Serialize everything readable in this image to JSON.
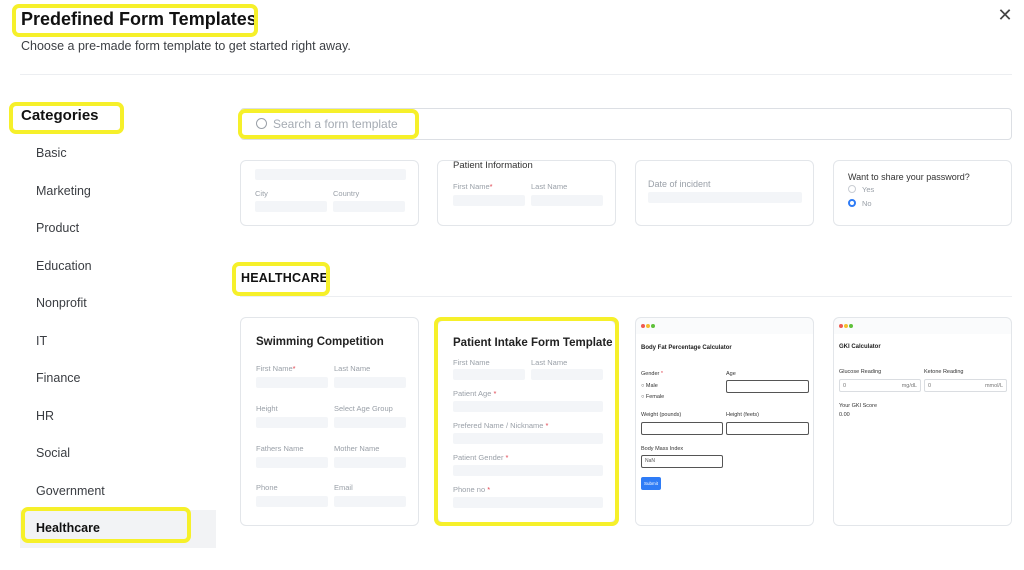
{
  "header": {
    "title": "Predefined Form Templates",
    "subtitle": "Choose a pre-made form template to get started right away.",
    "close_icon": "close-icon"
  },
  "sidebar": {
    "title": "Categories",
    "items": [
      {
        "label": "Basic"
      },
      {
        "label": "Marketing"
      },
      {
        "label": "Product"
      },
      {
        "label": "Education"
      },
      {
        "label": "Nonprofit"
      },
      {
        "label": "IT"
      },
      {
        "label": "Finance"
      },
      {
        "label": "HR"
      },
      {
        "label": "Social"
      },
      {
        "label": "Government"
      },
      {
        "label": "Healthcare",
        "active": true
      }
    ]
  },
  "search": {
    "placeholder": "Search a form template",
    "value": ""
  },
  "top_row": {
    "card1": {
      "fields": [
        "City",
        "Country"
      ]
    },
    "card2": {
      "title": "Patient Information",
      "fields": [
        "First Name",
        "Last Name"
      ]
    },
    "card3": {
      "fields": [
        "Date of incident"
      ]
    },
    "card4": {
      "question": "Want to share your password?",
      "options": [
        "Yes",
        "No"
      ],
      "selected": "No"
    }
  },
  "section": {
    "title": "HEALTHCARE"
  },
  "healthcare_cards": {
    "swimming": {
      "title": "Swimming Competition",
      "fields": [
        "First Name",
        "Last Name",
        "Height",
        "Select Age Group",
        "Fathers Name",
        "Mother Name",
        "Phone",
        "Email"
      ]
    },
    "intake": {
      "title": "Patient Intake Form Template",
      "fields": [
        "First Name",
        "Last Name",
        "Patient Age",
        "Prefered Name / Nickname",
        "Patient Gender",
        "Phone no"
      ]
    },
    "bodyfat": {
      "title": "Body Fat Percentage Calculator",
      "gender": "Gender",
      "age": "Age",
      "male": "Male",
      "female": "Female",
      "weight": "Weight (pounds)",
      "height": "Height (feets)",
      "bmi": "Body Mass Index",
      "bmi_value": "NaN",
      "submit": "Submit"
    },
    "gki": {
      "title": "GKI Calculator",
      "glucose": "Glucose Reading",
      "ketone": "Ketone Reading",
      "glucose_value": "0",
      "glucose_unit": "mg/dL",
      "ketone_value": "0",
      "ketone_unit": "mmol/L",
      "score_label": "Your GKI Score",
      "score_value": "0.00"
    }
  },
  "colors": {
    "accent": "#2f7cf6",
    "highlight": "#f6f02a",
    "required": "#e0434f"
  }
}
